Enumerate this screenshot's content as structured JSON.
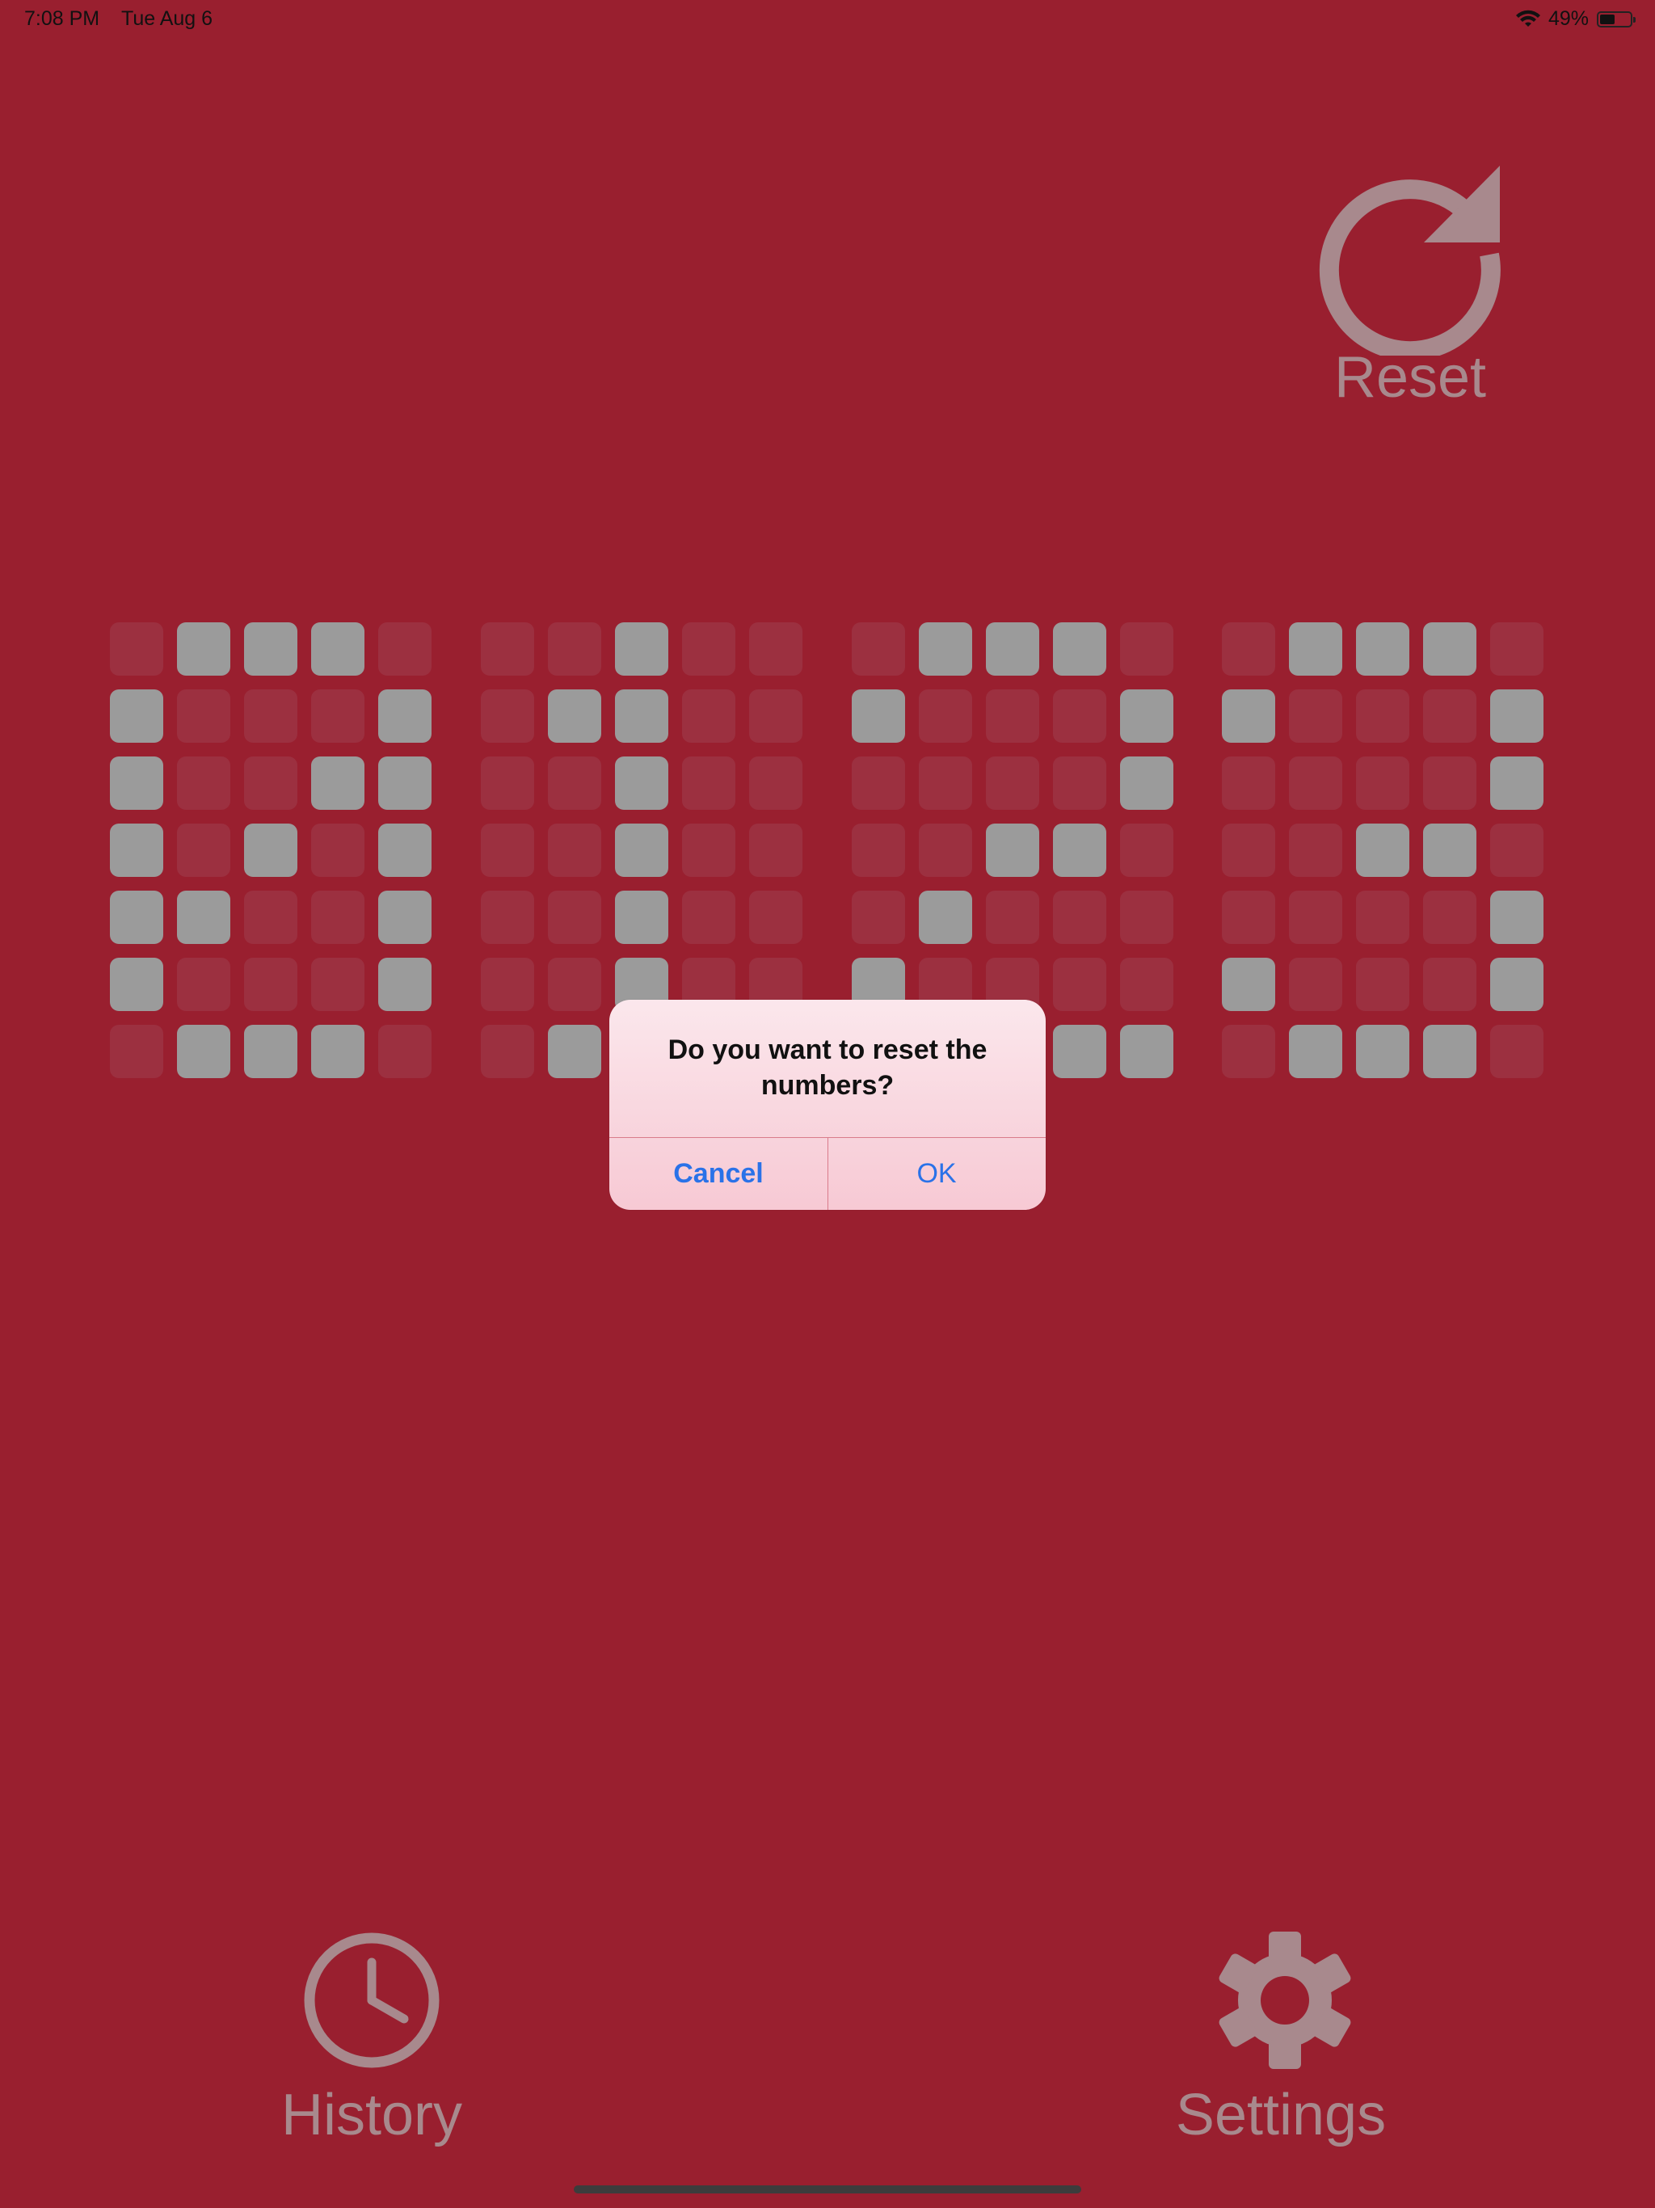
{
  "status_bar": {
    "time": "7:08 PM",
    "date": "Tue Aug 6",
    "battery_percent": "49%",
    "battery_level": 0.49,
    "wifi_icon": "wifi-icon"
  },
  "reset": {
    "label": "Reset",
    "icon": "reset-arrow-icon"
  },
  "display": {
    "on_color": "#9b9b9b",
    "off_color": "#9c3040",
    "digits": [
      [
        "01110",
        "10001",
        "10011",
        "10101",
        "11001",
        "10001",
        "01110"
      ],
      [
        "00100",
        "01100",
        "00100",
        "00100",
        "00100",
        "00100",
        "01110"
      ],
      [
        "01110",
        "10001",
        "00001",
        "00110",
        "01000",
        "10000",
        "11111"
      ],
      [
        "01110",
        "10001",
        "00001",
        "00110",
        "00001",
        "10001",
        "01110"
      ]
    ]
  },
  "alert": {
    "message": "Do you want to reset the numbers?",
    "cancel_label": "Cancel",
    "ok_label": "OK"
  },
  "bottom_bar": {
    "history_label": "History",
    "history_icon": "clock-icon",
    "settings_label": "Settings",
    "settings_icon": "gear-icon"
  },
  "colors": {
    "background": "#991f2f",
    "accent_link": "#2a72e8",
    "icon_gray": "#a8898d"
  }
}
